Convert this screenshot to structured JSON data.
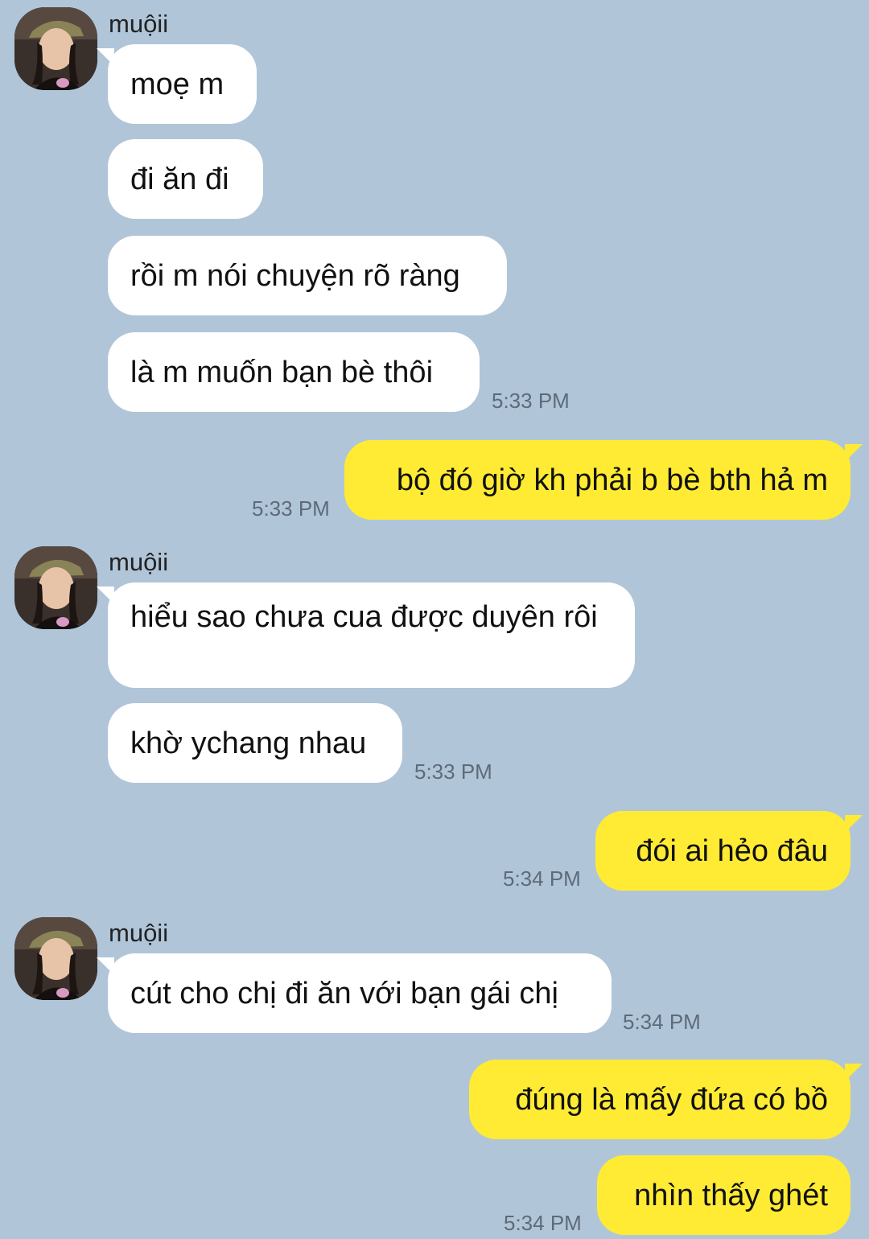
{
  "groups": [
    {
      "sender": "muộii",
      "messages": [
        "moẹ m",
        "đi ăn đi",
        "rồi m nói chuyện rõ ràng",
        "là m muốn bạn bè thôi"
      ],
      "time": "5:33 PM"
    },
    {
      "sender": "me",
      "messages": [
        "bộ đó giờ kh phải b bè bth hả m"
      ],
      "time": "5:33 PM"
    },
    {
      "sender": "muộii",
      "messages": [
        "hiểu sao chưa cua được duyên rôi",
        "khờ ychang nhau"
      ],
      "time": "5:33 PM"
    },
    {
      "sender": "me",
      "messages": [
        "đói ai hẻo đâu"
      ],
      "time": "5:34 PM"
    },
    {
      "sender": "muộii",
      "messages": [
        "cút cho chị đi ăn với bạn gái chị"
      ],
      "time": "5:34 PM"
    },
    {
      "sender": "me",
      "messages": [
        "đúng là mấy đứa có bồ",
        "nhìn thấy ghét"
      ],
      "time": "5:34 PM"
    }
  ],
  "icons": {
    "avatar": "profile-photo"
  },
  "colors": {
    "background": "#b1c5d9",
    "incoming_bubble": "#ffffff",
    "outgoing_bubble": "#ffeb33",
    "timestamp": "#5d6b78"
  }
}
